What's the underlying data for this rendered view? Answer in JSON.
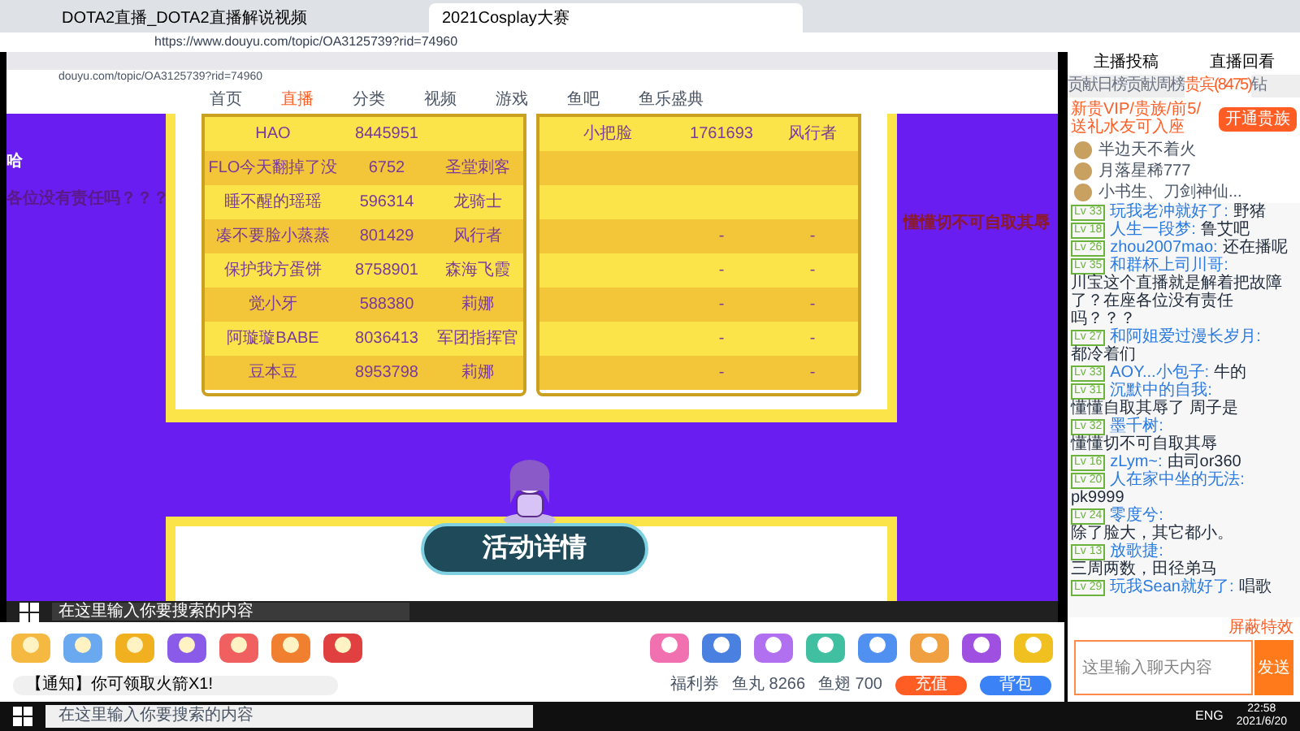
{
  "browser": {
    "tabs": [
      {
        "title": "DOTA2直播_DOTA2直播解说视频",
        "selected": false
      },
      {
        "title": "2021Cosplay大赛",
        "selected": true
      }
    ],
    "url": "https://www.douyu.com/topic/OA3125739?rid=74960"
  },
  "stream": {
    "inner_url": "douyu.com/topic/OA3125739?rid=74960",
    "nav": [
      {
        "label": "首页",
        "selected": false
      },
      {
        "label": "直播",
        "selected": true
      },
      {
        "label": "分类",
        "selected": false
      },
      {
        "label": "视频",
        "selected": false
      },
      {
        "label": "游戏",
        "selected": false
      },
      {
        "label": "鱼吧",
        "selected": false
      },
      {
        "label": "鱼乐盛典",
        "selected": false
      }
    ],
    "left_table": [
      {
        "kind": "entry",
        "name": "HAO",
        "score": "8445951"
      },
      {
        "kind": "entry",
        "name": "FLO今天翻掉了没",
        "score": "6752",
        "hero": "圣堂刺客"
      },
      {
        "kind": "entry",
        "name": "睡不醒的瑶瑶",
        "score": "596314",
        "hero": "龙骑士"
      },
      {
        "kind": "entry",
        "name": "凑不要脸小蒸蒸",
        "score": "801429",
        "hero": "风行者"
      },
      {
        "kind": "entry",
        "name": "保护我方蛋饼",
        "score": "8758901",
        "hero": "森海飞霞"
      },
      {
        "kind": "entry",
        "name": "觉小牙",
        "score": "588380",
        "hero": "莉娜"
      },
      {
        "kind": "entry",
        "name": "阿璇璇BABE",
        "score": "8036413",
        "hero": "军团指挥官"
      },
      {
        "kind": "entry",
        "name": "豆本豆",
        "score": "8953798",
        "hero": "莉娜"
      }
    ],
    "right_table": [
      {
        "kind": "entry",
        "name": "小把脸",
        "score": "1761693",
        "hero": "风行者"
      },
      {
        "kind": "blank"
      },
      {
        "kind": "blank"
      },
      {
        "kind": "entry",
        "score": "-",
        "hero": "-"
      },
      {
        "kind": "entry",
        "score": "-",
        "hero": "-"
      },
      {
        "kind": "entry",
        "score": "-",
        "hero": "-"
      },
      {
        "kind": "entry",
        "score": "-",
        "hero": "-"
      },
      {
        "kind": "entry",
        "score": "-",
        "hero": "-"
      }
    ],
    "banner": "活动详情",
    "danmaku": [
      {
        "text": "哈",
        "color": "#ffffff"
      },
      {
        "text": "各位没有责任吗？？？",
        "color": "#5b1a8a"
      },
      {
        "text": "懂懂切不可自取其辱",
        "color": "#8b1a2a"
      }
    ],
    "taskbar_search": "在这里输入你要搜索的内容"
  },
  "gift_bar": {
    "notice": "【通知】你可领取火箭X1!",
    "coupon": "福利券",
    "fish_balls": "鱼丸 8266",
    "fish_fins": "鱼翅 700",
    "recharge": "充值",
    "backpack": "背包"
  },
  "chat": {
    "header_tabs": [
      "主播投稿",
      "直播回看"
    ],
    "rank_tabs": [
      {
        "label": "贡献日榜",
        "selected": false
      },
      {
        "label": "贡献周榜",
        "selected": false
      },
      {
        "label": "贵宾(8475)",
        "selected": true
      },
      {
        "label": "钻",
        "selected": false
      }
    ],
    "vip_prompt": "新贵VIP/贵族/前5/送礼水友可入座",
    "open_button": "开通贵族",
    "guests": [
      {
        "name": "半边天不着火"
      },
      {
        "name": "月落星稀777"
      },
      {
        "name": "小书生、刀剑神仙..."
      }
    ],
    "messages": [
      {
        "level": "Lv 33",
        "user": "玩我老冲就好了:",
        "text": "野猪"
      },
      {
        "level": "Lv 18",
        "user": "人生一段梦:",
        "text": "鲁艾吧"
      },
      {
        "level": "Lv 26",
        "user": "zhou2007mao:",
        "text": "还在播呢"
      },
      {
        "level": "Lv 35",
        "user": "和群杯上司川哥:",
        "text": "川宝这个直播就是解着把故障了？在座各位没有责任吗？？？"
      },
      {
        "level": "Lv 27",
        "user": "和阿姐爱过漫长岁月:",
        "text": "都冷着们"
      },
      {
        "level": "Lv 33",
        "user": "AOY...小包子:",
        "text": "牛的"
      },
      {
        "level": "Lv 31",
        "user": "沉默中的自我:",
        "text": "懂懂自取其辱了 周子是"
      },
      {
        "level": "Lv 32",
        "user": "墨千树:",
        "text": "懂懂切不可自取其辱"
      },
      {
        "level": "Lv 16",
        "user": "zLym~:",
        "text": "由司or360"
      },
      {
        "level": "Lv 20",
        "user": "人在家中坐的无法:",
        "text": "pk9999"
      },
      {
        "level": "Lv 24",
        "user": "零度兮:",
        "text": "除了脸大，其它都小。"
      },
      {
        "level": "Lv 13",
        "user": "放歌捷:",
        "text": "三周两数，田径弟马"
      },
      {
        "level": "Lv 29",
        "user": "玩我Sean就好了:",
        "text": "唱歌"
      }
    ],
    "effects_toggle": "屏蔽特效",
    "input": {
      "placeholder": "这里输入聊天内容"
    },
    "send": "发送"
  },
  "taskbar": {
    "search": "在这里输入你要搜索的内容",
    "language": "ENG",
    "time": "22:58",
    "date": "2021/6/20"
  }
}
